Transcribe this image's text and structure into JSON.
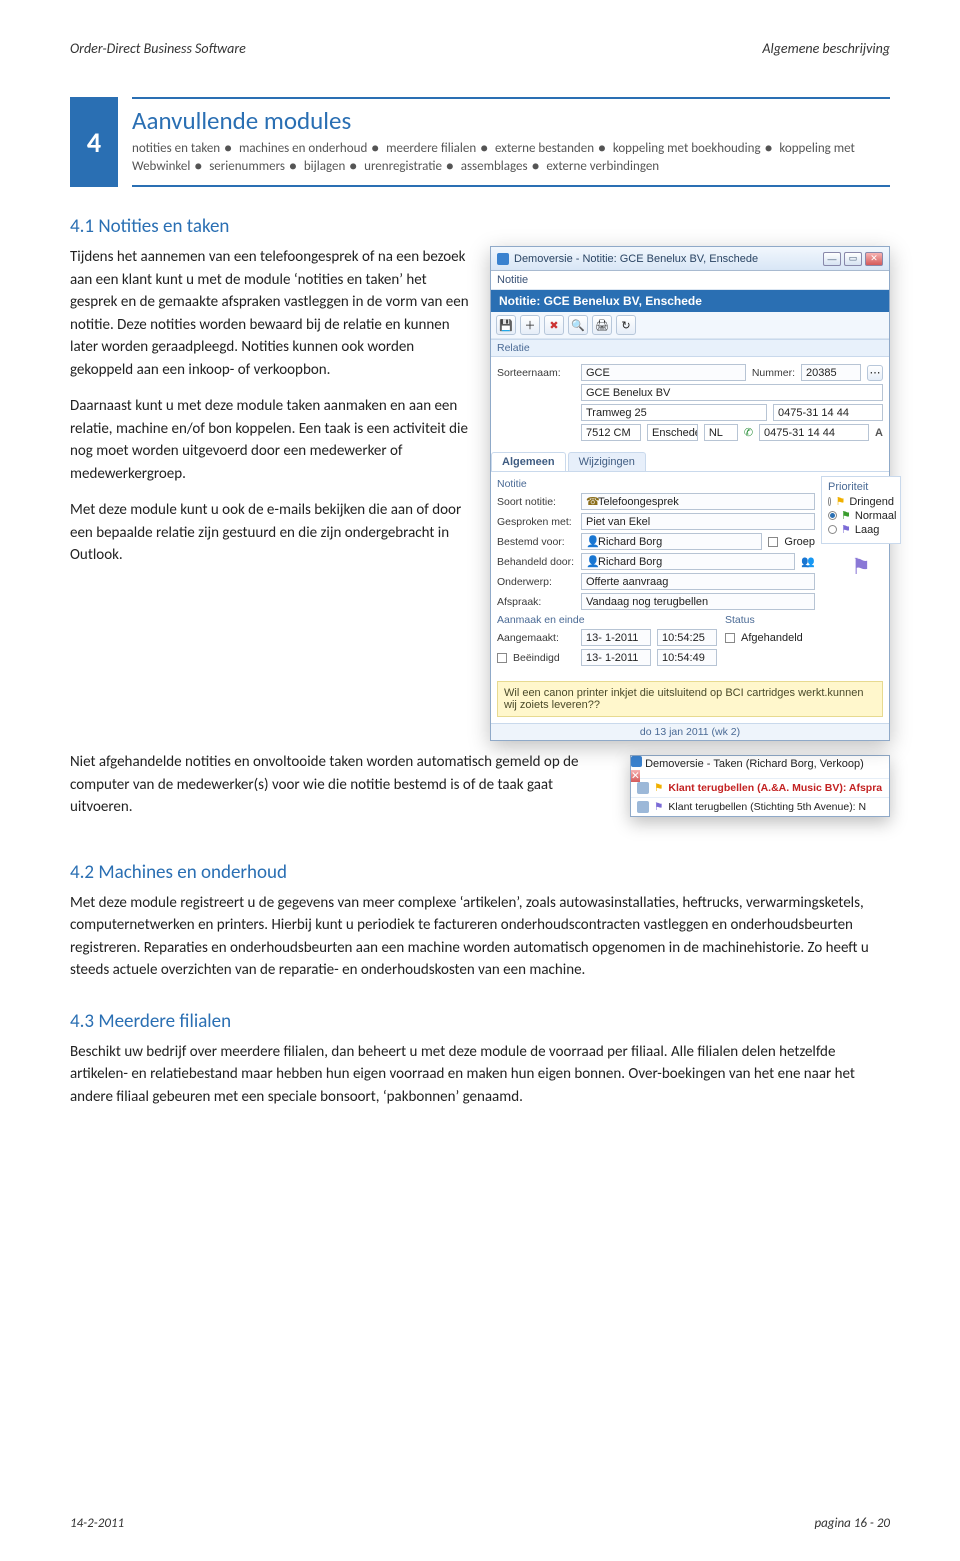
{
  "running_header": {
    "left": "Order-Direct Business Software",
    "right": "Algemene beschrijving"
  },
  "section": {
    "number": "4",
    "title": "Aanvullende modules",
    "subtitle_items": [
      "notities en taken",
      "machines en onderhoud",
      "meerdere filialen",
      "externe bestanden",
      "koppeling met boekhouding",
      "koppeling met Webwinkel",
      "serienummers",
      "bijlagen",
      "urenregistratie",
      "assemblages",
      "externe verbindingen"
    ]
  },
  "h41": "4.1 Notities en taken",
  "p1": "Tijdens het aannemen van een telefoongesprek of na een bezoek aan een klant kunt u met de module ‘notities en taken’ het gesprek en de gemaakte afspraken vastleggen in de vorm van een notitie. Deze notities worden bewaard bij de relatie en kunnen later worden geraadpleegd. Notities kunnen ook worden gekoppeld aan een inkoop- of verkoopbon.",
  "p2": "Daarnaast kunt u met deze module taken aanmaken en aan een relatie, machine en/of bon koppelen. Een taak is een activiteit die nog moet worden uitgevoerd door een medewerker of medewerkergroep.",
  "p3": "Met deze module kunt u ook de e-mails bekijken die aan of door een bepaalde relatie zijn gestuurd en die zijn ondergebracht in Outlook.",
  "p4a": "Niet afgehandelde notities en onvoltooide taken worden automatisch gemeld op de computer van de medewerker(s) voor wie die notitie bestemd is of de taak gaat uitvoeren.",
  "h42": "4.2 Machines en onderhoud",
  "p5": "Met deze module registreert u de gegevens van meer complexe ‘artikelen’, zoals autowasinstallaties, heftrucks, verwarmingsketels, computernetwerken en printers. Hierbij kunt u periodiek te factureren onderhoudscontracten vastleggen en onderhoudsbeurten registreren. Reparaties en onderhoudsbeurten aan een machine worden automatisch opgenomen in de machinehistorie. Zo heeft u steeds actuele overzichten van de reparatie- en onderhoudskosten van een machine.",
  "h43": "4.3 Meerdere filialen",
  "p6": "Beschikt uw bedrijf over meerdere filialen, dan beheert u met deze module de voorraad per filiaal. Alle filialen delen hetzelfde artikelen- en relatiebestand maar hebben hun eigen voorraad en maken hun eigen bonnen. Over-boekingen van het ene naar het andere filiaal gebeuren met een speciale bonsoort, ‘pakbonnen’ genaamd.",
  "footer": {
    "left": "14-2-2011",
    "right": "pagina 16 - 20"
  },
  "win": {
    "title": "Demoversie - Notitie: GCE Benelux BV, Enschede",
    "menubar": "Notitie",
    "blueband": "Notitie: GCE Benelux BV, Enschede",
    "relatie_label": "Relatie",
    "sorteernaam": {
      "label": "Sorteernaam:",
      "value": "GCE"
    },
    "nummer": {
      "label": "Nummer:",
      "value": "20385"
    },
    "company": "GCE Benelux BV",
    "street": "Tramweg 25",
    "zip": "7512 CM",
    "city": "Enschede",
    "country": "NL",
    "phone": "0475-31 14 44",
    "phonehint": "0475-31 14 44",
    "tab_general": "Algemeen",
    "tab_changes": "Wijzigingen",
    "notitie_label": "Notitie",
    "prioriteit_label": "Prioriteit",
    "prio_urgent": "Dringend",
    "prio_normal": "Normaal",
    "prio_low": "Laag",
    "soort": {
      "label": "Soort notitie:",
      "value": "Telefoongesprek"
    },
    "gesprokenmet": {
      "label": "Gesproken met:",
      "value": "Piet van Ekel"
    },
    "bestemdvoor": {
      "label": "Bestemd voor:",
      "value": "Richard Borg"
    },
    "behandelddoor": {
      "label": "Behandeld door:",
      "value": "Richard Borg"
    },
    "onderwerp": {
      "label": "Onderwerp:",
      "value": "Offerte aanvraag"
    },
    "afspraak": {
      "label": "Afspraak:",
      "value": "Vandaag nog terugbellen"
    },
    "groep": "Groep",
    "aanmaak_label": "Aanmaak en einde",
    "status_label": "Status",
    "aangemaakt": {
      "label": "Aangemaakt:",
      "date": "13- 1-2011",
      "time": "10:54:25"
    },
    "beeindigd": {
      "label": "Beëindigd",
      "date": "13- 1-2011",
      "time": "10:54:49"
    },
    "afgehandeld": "Afgehandeld",
    "note_text": "Wil een canon printer inkjet die uitsluitend op BCI cartridges werkt.kunnen wij zoiets leveren??",
    "statusbar": "do 13 jan 2011 (wk 2)"
  },
  "popup": {
    "title": "Demoversie - Taken (Richard Borg, Verkoop)",
    "item1": "Klant terugbellen (A.&A. Music BV): Afspra",
    "item2": "Klant terugbellen (Stichting 5th Avenue): N"
  }
}
